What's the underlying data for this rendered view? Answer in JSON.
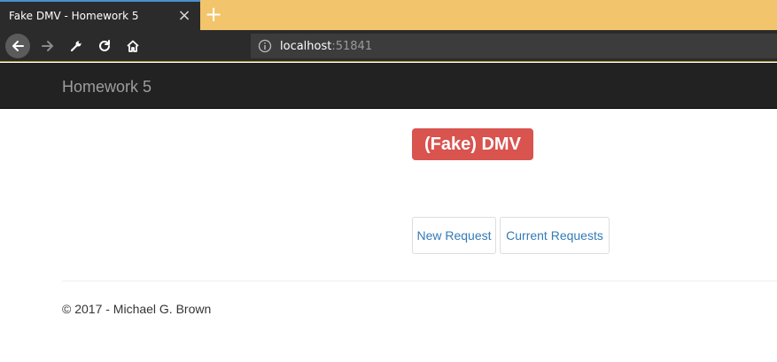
{
  "browser": {
    "tab_title": "Fake DMV - Homework 5",
    "tab_close_glyph": "×",
    "new_tab_glyph": "+",
    "url_host": "localhost",
    "url_port": ":51841",
    "icons": [
      "back-arrow-icon",
      "forward-arrow-icon",
      "wrench-icon",
      "reload-icon",
      "home-icon",
      "info-icon"
    ],
    "colors": {
      "tabstrip": "#f2c46b",
      "chrome": "#2b2b2b",
      "active_tab_accent": "#4a8fd0"
    }
  },
  "navbar": {
    "brand": "Homework 5"
  },
  "main": {
    "title": "(Fake) DMV",
    "buttons": {
      "new_request": "New Request",
      "current_requests": "Current Requests"
    }
  },
  "footer": {
    "text": "© 2017 - Michael G. Brown"
  },
  "colors": {
    "label_danger": "#d9534f",
    "link": "#337ab7",
    "navbar": "#222222"
  }
}
